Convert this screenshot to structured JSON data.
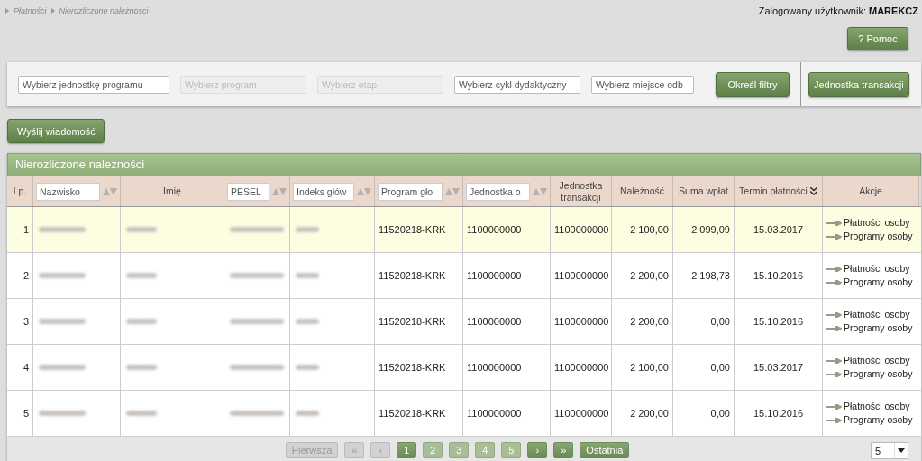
{
  "breadcrumb": [
    "Płatności",
    "Nierozliczone należności"
  ],
  "user": {
    "label": "Zalogowany użytkownik:",
    "name": "MAREKCZ"
  },
  "help_button": {
    "icon": "?",
    "label": "Pomoc"
  },
  "filters": [
    {
      "placeholder": "Wybierz jednostkę programu",
      "disabled": false
    },
    {
      "placeholder": "Wybierz program",
      "disabled": true
    },
    {
      "placeholder": "Wybierz etap",
      "disabled": true
    },
    {
      "placeholder": "Wybierz cykl dydaktyczny",
      "disabled": false
    },
    {
      "placeholder": "Wybierz miejsce odb",
      "disabled": false
    }
  ],
  "filter_button": "Określ filtry",
  "unit_button": "Jednostka transakcji",
  "send_button": "Wyślij wiadomość",
  "table": {
    "title": "Nierozliczone należności",
    "columns": [
      {
        "kind": "label",
        "label": "Lp."
      },
      {
        "kind": "filter",
        "placeholder": "Nazwisko"
      },
      {
        "kind": "label",
        "label": "Imię"
      },
      {
        "kind": "filter",
        "placeholder": "PESEL"
      },
      {
        "kind": "filter",
        "placeholder": "Indeks głów"
      },
      {
        "kind": "filter",
        "placeholder": "Program gło"
      },
      {
        "kind": "filter",
        "placeholder": "Jednostka o"
      },
      {
        "kind": "label",
        "label": "Jednostka transakcji"
      },
      {
        "kind": "label",
        "label": "Należność"
      },
      {
        "kind": "label",
        "label": "Suma wpłat"
      },
      {
        "kind": "sorted",
        "label": "Termin płatności"
      },
      {
        "kind": "label",
        "label": "Akcje"
      }
    ],
    "rows": [
      {
        "selected": true,
        "lp": "1",
        "program": "11520218-KRK",
        "unit": "1100000000",
        "tx_unit": "1100000000",
        "due": "2 100,00",
        "paid": "2 099,09",
        "date": "15.03.2017",
        "actions": [
          "Płatności osoby",
          "Programy osoby"
        ]
      },
      {
        "selected": false,
        "lp": "2",
        "program": "11520218-KRK",
        "unit": "1100000000",
        "tx_unit": "1100000000",
        "due": "2 200,00",
        "paid": "2 198,73",
        "date": "15.10.2016",
        "actions": [
          "Płatności osoby",
          "Programy osoby"
        ]
      },
      {
        "selected": false,
        "lp": "3",
        "program": "11520218-KRK",
        "unit": "1100000000",
        "tx_unit": "1100000000",
        "due": "2 200,00",
        "paid": "0,00",
        "date": "15.10.2016",
        "actions": [
          "Płatności osoby",
          "Programy osoby"
        ]
      },
      {
        "selected": false,
        "lp": "4",
        "program": "11520218-KRK",
        "unit": "1100000000",
        "tx_unit": "1100000000",
        "due": "2 100,00",
        "paid": "0,00",
        "date": "15.03.2017",
        "actions": [
          "Płatności osoby",
          "Programy osoby"
        ]
      },
      {
        "selected": false,
        "lp": "5",
        "program": "11520218-KRK",
        "unit": "1100000000",
        "tx_unit": "1100000000",
        "due": "2 200,00",
        "paid": "0,00",
        "date": "15.10.2016",
        "actions": [
          "Płatności osoby",
          "Programy osoby"
        ]
      }
    ]
  },
  "pagination": {
    "first": {
      "label": "Pierwsza",
      "disabled": true
    },
    "prev_group": {
      "label": "«",
      "disabled": true
    },
    "prev": {
      "label": "‹",
      "disabled": true
    },
    "pages": [
      {
        "label": "1",
        "selected": true
      },
      {
        "label": "2",
        "selected": false
      },
      {
        "label": "3",
        "selected": false
      },
      {
        "label": "4",
        "selected": false
      },
      {
        "label": "5",
        "selected": false
      }
    ],
    "next": {
      "label": "›",
      "disabled": false
    },
    "next_group": {
      "label": "»",
      "disabled": false
    },
    "last": {
      "label": "Ostatnia",
      "disabled": false
    },
    "page_size": "5"
  }
}
